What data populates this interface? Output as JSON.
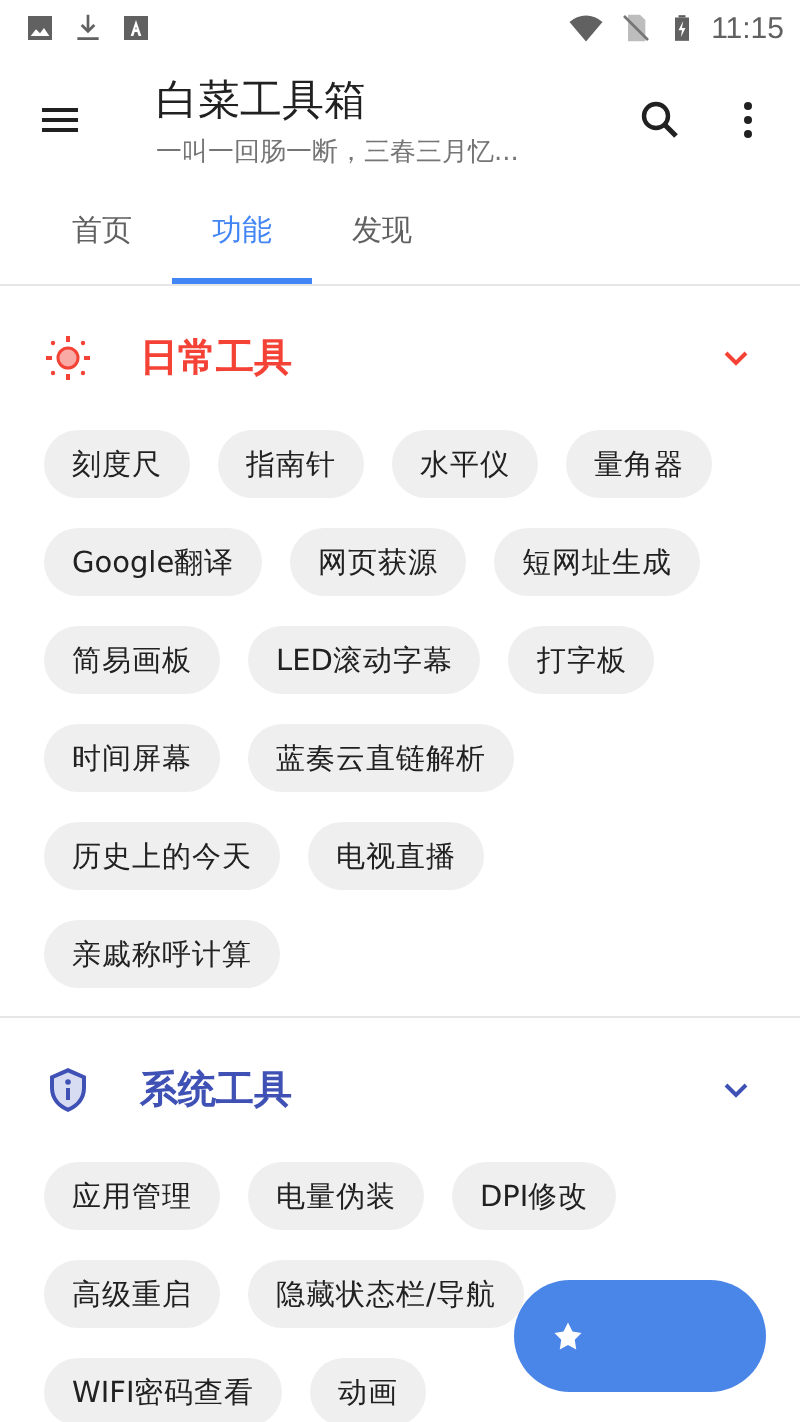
{
  "status_bar": {
    "time": "11:15"
  },
  "toolbar": {
    "title": "白菜工具箱",
    "subtitle": "一叫一回肠一断，三春三月忆..."
  },
  "tabs": [
    {
      "label": "首页",
      "selected": false
    },
    {
      "label": "功能",
      "selected": true
    },
    {
      "label": "发现",
      "selected": false
    }
  ],
  "sections": [
    {
      "kind": "daily",
      "title": "日常工具",
      "color": "#f44336",
      "items": [
        "刻度尺",
        "指南针",
        "水平仪",
        "量角器",
        "Google翻译",
        "网页获源",
        "短网址生成",
        "简易画板",
        "LED滚动字幕",
        "打字板",
        "时间屏幕",
        "蓝奏云直链解析",
        "历史上的今天",
        "电视直播",
        "亲戚称呼计算"
      ]
    },
    {
      "kind": "system",
      "title": "系统工具",
      "color": "#3f51b5",
      "items": [
        "应用管理",
        "电量伪装",
        "DPI修改",
        "高级重启",
        "隐藏状态栏/导航",
        "WIFI密码查看",
        "动画"
      ]
    }
  ]
}
